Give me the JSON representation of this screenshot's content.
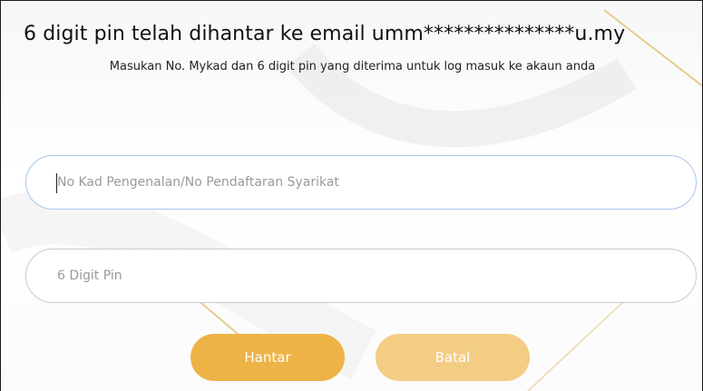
{
  "header": {
    "title": "6 digit pin telah dihantar ke email umm***************u.my",
    "instruction": "Masukan No. Mykad dan 6 digit pin yang diterima untuk log masuk ke akaun anda"
  },
  "form": {
    "ic_field": {
      "placeholder": "No Kad Pengenalan/No Pendaftaran Syarikat",
      "value": ""
    },
    "pin_field": {
      "placeholder": "6 Digit Pin",
      "value": ""
    }
  },
  "actions": {
    "submit_label": "Hantar",
    "cancel_label": "Batal"
  },
  "colors": {
    "accent": "#eeb347",
    "accent_light": "#f4cd85",
    "focus_border": "#a7c6ea"
  }
}
